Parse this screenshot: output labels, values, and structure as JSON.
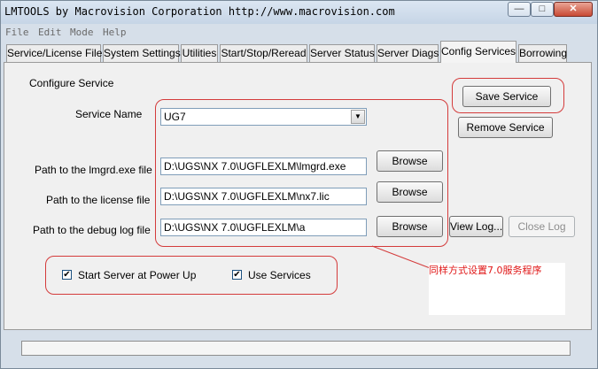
{
  "window": {
    "title": "LMTOOLS by Macrovision Corporation http://www.macrovision.com",
    "minimize_glyph": "—",
    "maximize_glyph": "□",
    "close_glyph": "✕"
  },
  "menu": [
    "File",
    "Edit",
    "Mode",
    "Help"
  ],
  "tabs": [
    "Service/License File",
    "System Settings",
    "Utilities",
    "Start/Stop/Reread",
    "Server Status",
    "Server Diags",
    "Config Services",
    "Borrowing"
  ],
  "active_tab": "Config Services",
  "config": {
    "section_label": "Configure Service",
    "service_name_label": "Service Name",
    "service_name_value": "UG7",
    "lmgrd_label": "Path to the lmgrd.exe file",
    "lmgrd_value": "D:\\UGS\\NX 7.0\\UGFLEXLM\\lmgrd.exe",
    "license_label": "Path to the license file",
    "license_value": "D:\\UGS\\NX 7.0\\UGFLEXLM\\nx7.lic",
    "debug_label": "Path to the debug log file",
    "debug_value": "D:\\UGS\\NX 7.0\\UGFLEXLM\\a",
    "browse_label": "Browse",
    "save_service": "Save Service",
    "remove_service": "Remove Service",
    "view_log": "View Log...",
    "close_log": "Close Log",
    "start_server_label": "Start Server at Power Up",
    "start_server_checked": true,
    "use_services_label": "Use Services",
    "use_services_checked": true,
    "check_glyph": "✔"
  },
  "annotation": {
    "text": "同样方式设置7.0服务程序",
    "color": "#e01818"
  },
  "status": ""
}
